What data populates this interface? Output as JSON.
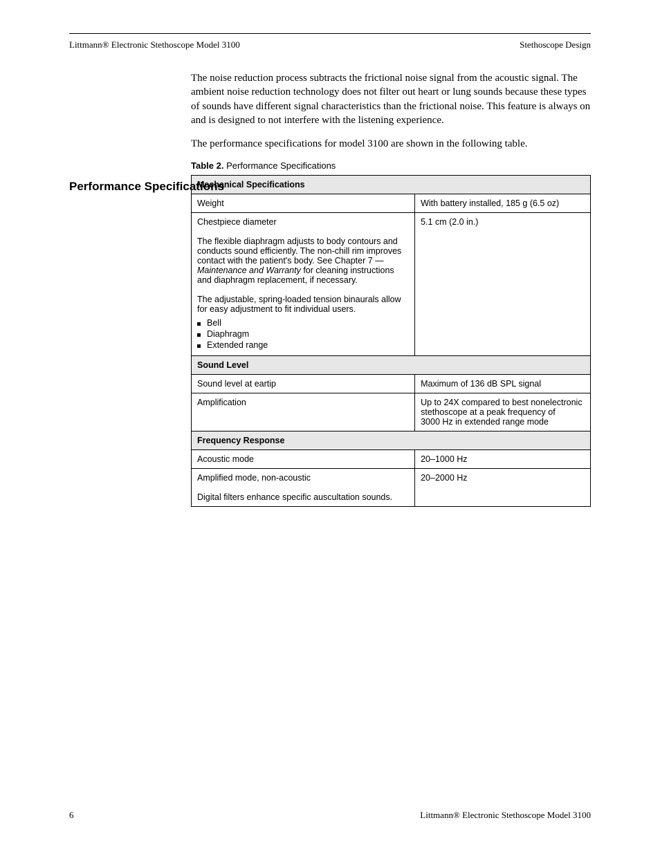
{
  "header": {
    "left": "Littmann® Electronic Stethoscope Model 3100",
    "right": "Stethoscope Design"
  },
  "intro": {
    "p1": "The noise reduction process subtracts the frictional noise signal from the acoustic signal. The ambient noise reduction technology does not filter out heart or lung sounds because these types of sounds have different signal characteristics than the frictional noise. This feature is always on and is designed to not interfere with the listening experience.",
    "p2": "The performance specifications for model 3100 are shown in the following table."
  },
  "sidehead": "Performance Specifications",
  "table": {
    "caption_label": "Table 2.",
    "caption_text": " Performance Specifications",
    "sections": [
      {
        "title": "Mechanical Specifications",
        "rows": [
          {
            "c1": "Weight",
            "c2_html": "With battery installed, 185&nbsp;g (6.5&nbsp;oz)"
          },
          {
            "c1_html": "Chestpiece diameter<br><br>The flexible diaphragm adjusts to body contours and conducts sound efficiently. The non-chill rim improves contact with the patient's body. See Chapter&nbsp;7 <em>— Maintenance and Warranty</em> for cleaning instructions and diaphragm replacement, if necessary.<br><br>The adjustable, spring-loaded tension binaurals allow for easy adjustment to fit individual users.",
            "c2_html": "5.1&nbsp;cm (2.0&nbsp;in.)",
            "bullets": [
              "Bell",
              "Diaphragm",
              "Extended range"
            ]
          }
        ]
      },
      {
        "title": "Sound Level",
        "rows": [
          {
            "c1": "Sound level at eartip",
            "c2_html": "Maximum of 136&nbsp;dB SPL signal"
          },
          {
            "c1": "Amplification",
            "c2_html": "Up to 24X compared to best nonelectronic stethoscope at a peak frequency of 3000&nbsp;Hz in extended range mode"
          }
        ]
      },
      {
        "title": "Frequency Response",
        "rows": [
          {
            "c1": "Acoustic mode",
            "c2_html": "20&ndash;1000&nbsp;Hz"
          },
          {
            "c1_html": "Amplified mode, non-acoustic<br><br>Digital filters enhance specific auscultation sounds.",
            "c2_html": "20&ndash;2000&nbsp;Hz"
          }
        ]
      }
    ]
  },
  "footer": {
    "left": "6",
    "right": "Littmann® Electronic Stethoscope Model 3100"
  }
}
